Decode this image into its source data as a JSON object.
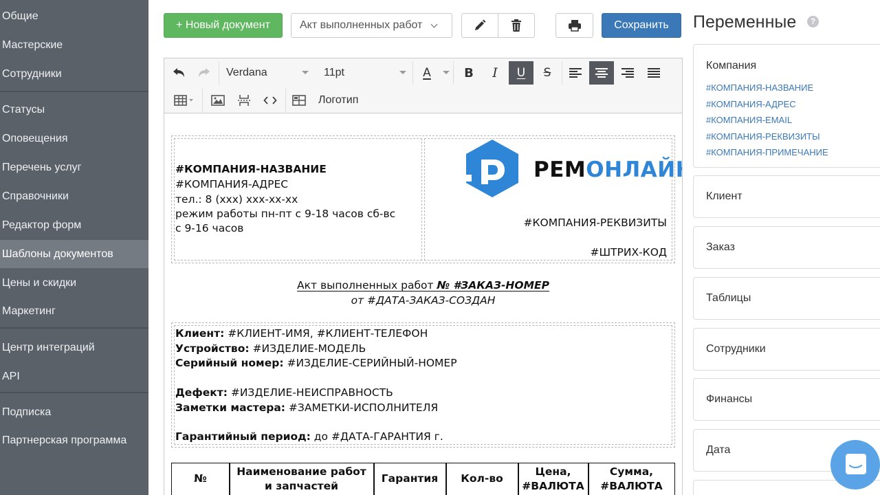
{
  "sidebar": {
    "items": [
      {
        "label": "Общие"
      },
      {
        "label": "Мастерские"
      },
      {
        "label": "Сотрудники"
      },
      {
        "label": "Статусы"
      },
      {
        "label": "Оповещения"
      },
      {
        "label": "Перечень услуг"
      },
      {
        "label": "Справочники"
      },
      {
        "label": "Редактор форм"
      },
      {
        "label": "Шаблоны документов"
      },
      {
        "label": "Цены и скидки"
      },
      {
        "label": "Маркетинг"
      },
      {
        "label": "Центр интеграций"
      },
      {
        "label": "API"
      },
      {
        "label": "Подписка"
      },
      {
        "label": "Партнерская программа"
      }
    ],
    "active": "Шаблоны документов"
  },
  "toolbar": {
    "new_doc_label": "+ Новый документ",
    "template_select_value": "Акт выполненных работ",
    "save_label": "Сохранить",
    "icons": [
      "pencil-icon",
      "trash-icon",
      "printer-icon"
    ]
  },
  "editor_toolbar": {
    "font_family": "Verdana",
    "font_size": "11pt",
    "text_color_glyph": "A",
    "logo_label": "Логотип",
    "active_buttons": [
      "underline",
      "align-center"
    ]
  },
  "document": {
    "header_left": {
      "company_name": "#КОМПАНИЯ-НАЗВАНИЕ",
      "company_address": "#КОМПАНИЯ-АДРЕС",
      "phone": "тел.: 8 (ххх) ххх-хх-хх",
      "hours_line1": "режим работы  пн-пт с 9-18 часов  сб-вс",
      "hours_line2": "с 9-16 часов"
    },
    "header_right": {
      "logo_text_dark": "РЕМ",
      "logo_text_blue": "ОНЛАЙН",
      "requisites": "#КОМПАНИЯ-РЕКВИЗИТЫ",
      "barcode": "#ШТРИХ-КОД"
    },
    "title_plain": "Акт выполненных работ ",
    "title_bold": "№ #ЗАКАЗ-НОМЕР",
    "subtitle": "от #ДАТА-ЗАКАЗ-СОЗДАН",
    "info": {
      "client_label": "Клиент:",
      "client_value": " #КЛИЕНТ-ИМЯ, #КЛИЕНТ-ТЕЛЕФОН",
      "device_label": "Устройство:",
      "device_value": " #ИЗДЕЛИЕ-МОДЕЛЬ",
      "serial_label": "Серийный номер:",
      "serial_value": " #ИЗДЕЛИЕ-СЕРИЙНЫЙ-НОМЕР",
      "defect_label": "Дефект:",
      "defect_value": " #ИЗДЕЛИЕ-НЕИСПРАВНОСТЬ",
      "notes_label": "Заметки мастера:",
      "notes_value": " #ЗАМЕТКИ-ИСПОЛНИТЕЛЯ",
      "warranty_label": "Гарантийный период:",
      "warranty_value": " до #ДАТА-ГАРАНТИЯ г."
    },
    "table_headers": [
      {
        "line1": "№",
        "line2": ""
      },
      {
        "line1": "Наименование работ",
        "line2": "и запчастей"
      },
      {
        "line1": "Гарантия",
        "line2": ""
      },
      {
        "line1": "Кол-во",
        "line2": ""
      },
      {
        "line1": "Цена,",
        "line2": "#ВАЛЮТА"
      },
      {
        "line1": "Сумма,",
        "line2": "#ВАЛЮТА"
      }
    ]
  },
  "variables_panel": {
    "title": "Переменные",
    "help_glyph": "?",
    "groups": [
      {
        "title": "Компания",
        "items": [
          "#КОМПАНИЯ-НАЗВАНИЕ",
          "#КОМПАНИЯ-АДРЕС",
          "#КОМПАНИЯ-EMAIL",
          "#КОМПАНИЯ-РЕКВИЗИТЫ",
          "#КОМПАНИЯ-ПРИМЕЧАНИЕ"
        ]
      },
      {
        "title": "Клиент"
      },
      {
        "title": "Заказ"
      },
      {
        "title": "Таблицы"
      },
      {
        "title": "Сотрудники"
      },
      {
        "title": "Финансы"
      },
      {
        "title": "Дата"
      }
    ]
  },
  "colors": {
    "sidebar_bg": "#5b6169",
    "sidebar_active": "#757b83",
    "green": "#5fb760",
    "blue": "#3a78b8",
    "logo_blue": "#2f86d7",
    "link_blue": "#3a78b8"
  }
}
